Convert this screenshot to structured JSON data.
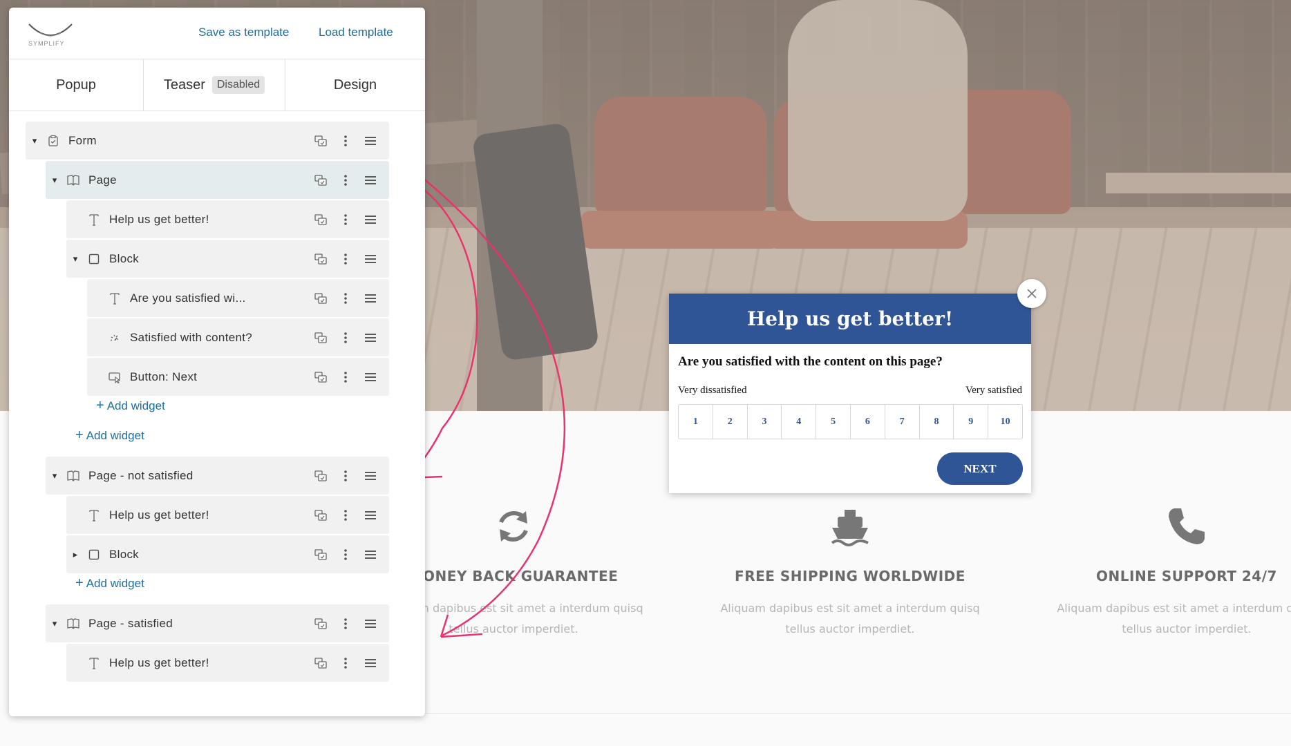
{
  "editor": {
    "logo_text": "SYMPLIFY",
    "save_template": "Save as template",
    "load_template": "Load template",
    "tabs": [
      {
        "label": "Popup"
      },
      {
        "label": "Teaser",
        "badge": "Disabled"
      },
      {
        "label": "Design"
      }
    ],
    "tree": [
      {
        "label": "Form",
        "icon": "form-icon",
        "caret": "down"
      },
      {
        "label": "Page",
        "icon": "page-icon",
        "caret": "down",
        "active": true
      },
      {
        "label": "Help us get better!",
        "icon": "text-icon"
      },
      {
        "label": "Block",
        "icon": "block-icon",
        "caret": "down"
      },
      {
        "label": "Are you satisfied wi...",
        "icon": "text-icon"
      },
      {
        "label": "Satisfied with content?",
        "icon": "rating-icon"
      },
      {
        "label": "Button: Next",
        "icon": "button-icon"
      },
      {
        "label": "Page - not satisfied",
        "icon": "page-icon",
        "caret": "down"
      },
      {
        "label": "Help us get better!",
        "icon": "text-icon"
      },
      {
        "label": "Block",
        "icon": "block-icon",
        "caret": "right"
      },
      {
        "label": "Page - satisfied",
        "icon": "page-icon",
        "caret": "down"
      },
      {
        "label": "Help us get better!",
        "icon": "text-icon"
      }
    ],
    "add_widget": "Add widget"
  },
  "popup": {
    "title": "Help us get better!",
    "question": "Are you satisfied with the content on this page?",
    "low_label": "Very dissatisfied",
    "high_label": "Very satisfied",
    "scale": [
      "1",
      "2",
      "3",
      "4",
      "5",
      "6",
      "7",
      "8",
      "9",
      "10"
    ],
    "next": "NEXT",
    "accent": "#2f5597"
  },
  "features": [
    {
      "icon": "refresh-icon",
      "title": "MONEY BACK GUARANTEE",
      "line1": "Aliquam dapibus est sit amet a interdum quisq",
      "line2": "tellus auctor imperdiet."
    },
    {
      "icon": "ship-icon",
      "title": "FREE SHIPPING WORLDWIDE",
      "line1": "Aliquam dapibus est sit amet a interdum quisq",
      "line2": "tellus auctor imperdiet."
    },
    {
      "icon": "phone-icon",
      "title": "ONLINE SUPPORT 24/7",
      "line1": "Aliquam dapibus est sit amet a interdum quisq",
      "line2": "tellus auctor imperdiet."
    }
  ],
  "annotation_color": "#e8336b"
}
